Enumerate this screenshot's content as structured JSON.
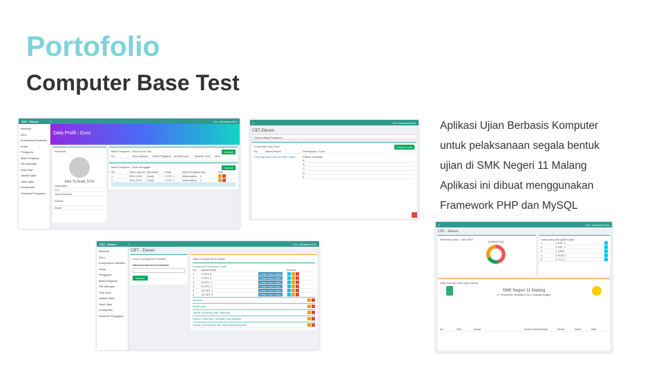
{
  "heading": {
    "title": "Portofolio",
    "subtitle": "Computer Base Test"
  },
  "description": [
    "Aplikasi Ujian Berbasis Komputer",
    "untuk pelaksanaan segala bentuk",
    "ujian di SMK Negeri 11 Malang",
    "Aplikasi ini dibuat menggunakan",
    "Framework PHP dan MySQL"
  ],
  "app": {
    "brand": "CBT - Eleven",
    "user": "Drs. Gunawan Eko",
    "sidebar": [
      "Beranda",
      "Guru",
      "Kompetensi Keahlian",
      "Kelas",
      "Pengguna",
      "Mata Pelajaran",
      "File Manager",
      "Soal-Soal",
      "Jadwal Ujian",
      "Hasil Ujian",
      "Konfigurasi",
      "Panduan Pengguna"
    ]
  },
  "shot1": {
    "banner": "Data Profil - Guru",
    "info": "Informasi",
    "name": "Alan Tri Anafi, S.Pd",
    "card1": "Mata Pelajaran - Data Input Soal",
    "card2": "Mata Pelajaran - Data Mengajar",
    "add": "Tambah",
    "fields": [
      "Username",
      "TTL",
      "Jenis Kelamin",
      "Alamat",
      "Email"
    ],
    "cols1": [
      "No",
      "Tahun Ajaran",
      "Mata Pelajaran",
      "Jumlah Soal",
      "Tambah Soal",
      "Aksi"
    ],
    "cols2": [
      "No",
      "Tahun Ajaran",
      "Semester",
      "Kelas",
      "Mata Pelajaran",
      "Jam",
      "Aksi"
    ],
    "rows2": [
      [
        "1",
        "2019-2020",
        "Ganjil",
        "X RPL 1",
        "Matematika",
        "4"
      ],
      [
        "2",
        "2019-2020",
        "Ganjil",
        "X RPL 2",
        "Matematika",
        "4"
      ]
    ]
  },
  "shot2": {
    "title": "CBT-Eleven",
    "select": "Semua Mata Pelajaran",
    "card": "Kumpulan Soal-Soal",
    "add": "Tambah Soal",
    "cols": [
      "No",
      "Nama Mapel",
      "Pertanyaan / Soal"
    ],
    "choices_label": "Pilihan Jawaban",
    "choices": [
      "A.",
      "B.",
      "C.",
      "D.",
      "E."
    ],
    "subject": "Pemrograman Berorientasi Objek"
  },
  "shot3": {
    "title": "CBT - Eleven",
    "form": "Form Kompetensi Keahlian",
    "field": "Nama Kompetensi Keahlian",
    "save": "Simpan",
    "list": "Data Kompetensi Keahlian",
    "group1": "Rekayasa Perangkat Lunak",
    "cols": [
      "No",
      "Nama Kelas",
      "Actions"
    ],
    "classes": [
      "X RPL 1",
      "X RPL 2",
      "XI RPL 1",
      "XI RPL 2",
      "XII RPL 1",
      "XII RPL 2"
    ],
    "cetak": "Cetak Kartu Ujian",
    "groups": [
      "Animasi",
      "Multimedia",
      "Teknik Komputer dan Jaringan",
      "Sistem Informasi, Jaringan dan Aplikasi",
      "Desain Pemodelan dan Informasi Bangunan"
    ]
  },
  "shot4": {
    "title": "CBT - Eleven",
    "info": "Informasi Ujian - UAS PBO",
    "analisa": "Analisa Soal",
    "classes_card": "Kelas yang Mengikuti Ujian",
    "school": "SMK Negeri 11 Malang",
    "address": "Jl. Pelabuhan Bakahuni No 1 Bakalankrajan",
    "results": "Data Seluruh Hasil Ujian Siswa",
    "cols": [
      "No",
      "NIS",
      "Nama",
      "Jenis Kelamin",
      "Kelas",
      "Benar",
      "Salah",
      "Nilai"
    ],
    "kelas": [
      "X RPL 1",
      "X RPL 2",
      "X DPIB",
      "X SIJA 1",
      "X TKJ 1"
    ]
  }
}
